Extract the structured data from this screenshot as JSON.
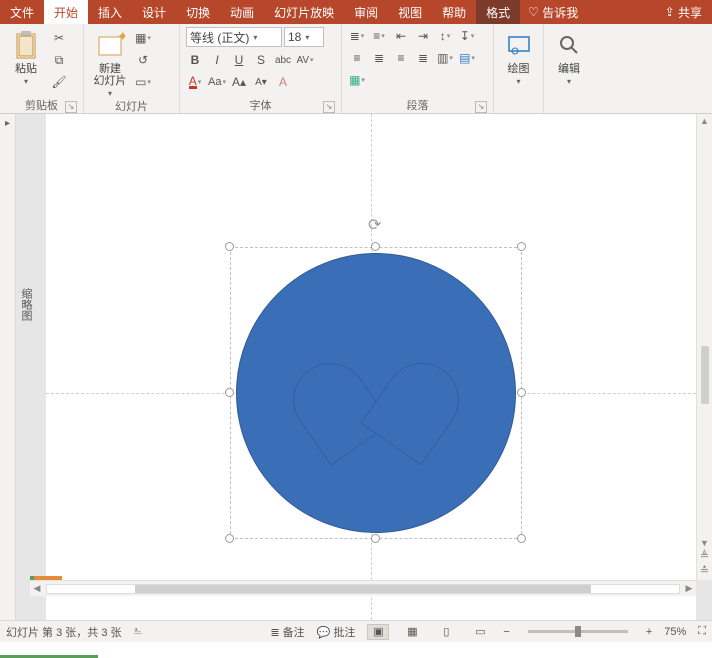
{
  "tabs": {
    "file": "文件",
    "home": "开始",
    "insert": "插入",
    "design": "设计",
    "transition": "切换",
    "animation": "动画",
    "slideshow": "幻灯片放映",
    "review": "审阅",
    "view": "视图",
    "help": "帮助",
    "format": "格式",
    "tellme": "告诉我",
    "share": "共享"
  },
  "ribbon": {
    "clipboard": {
      "paste": "粘贴",
      "label": "剪贴板"
    },
    "slides": {
      "new": "新建\n幻灯片",
      "label": "幻灯片"
    },
    "font": {
      "label": "字体",
      "name": "等线 (正文)",
      "size": "18",
      "bold": "B",
      "italic": "I",
      "underline": "U",
      "strike": "S",
      "shadow": "abc",
      "charSpacing": "AV",
      "changeCase": "Aa",
      "clear": "A"
    },
    "paragraph": {
      "label": "段落"
    },
    "drawing": {
      "label": "绘图"
    },
    "editing": {
      "label": "编辑"
    }
  },
  "outline": {
    "label": "缩略图"
  },
  "status": {
    "slide": "幻灯片 第 3 张，共 3 张",
    "notes": "备注",
    "comments": "批注",
    "zoom": "75%"
  }
}
